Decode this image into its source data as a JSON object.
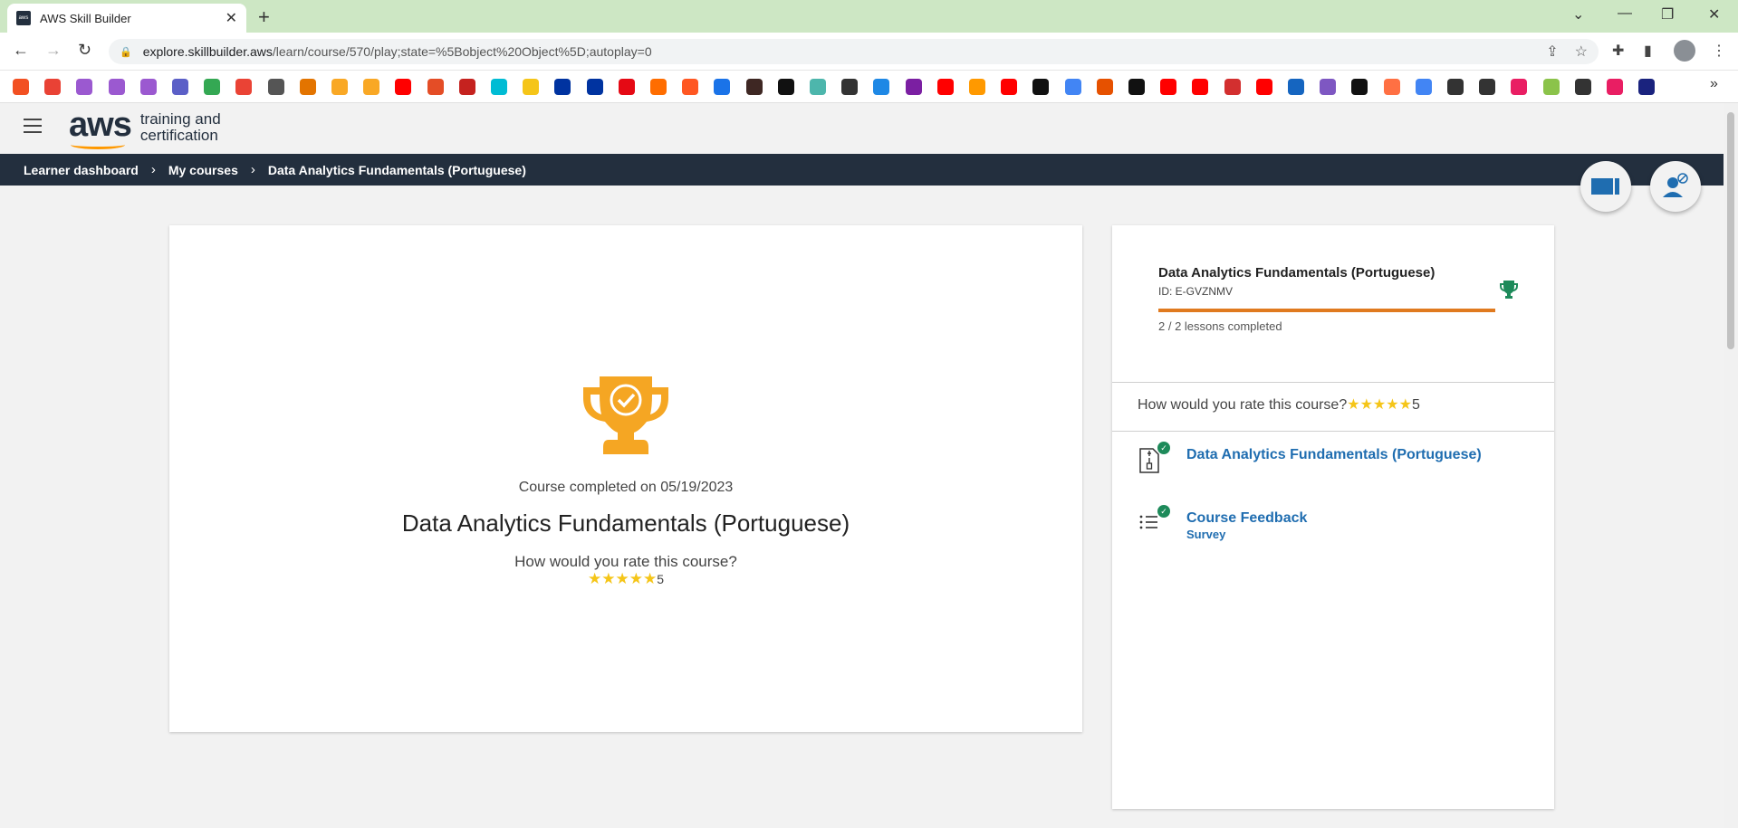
{
  "browser": {
    "tab_title": "AWS Skill Builder",
    "url_host": "explore.skillbuilder.aws",
    "url_path": "/learn/course/570/play;state=%5Bobject%20Object%5D;autoplay=0",
    "bookmark_colors": [
      "#f25022",
      "#e94235",
      "#9b59d0",
      "#9b59d0",
      "#9b59d0",
      "#5b5fc7",
      "#34a853",
      "#ea4335",
      "#555",
      "#e37400",
      "#f9a825",
      "#f9a825",
      "#ff0000",
      "#e44d26",
      "#c5221f",
      "#00bcd4",
      "#f5c518",
      "#0033a0",
      "#0033a0",
      "#e50914",
      "#ff6d00",
      "#ff5722",
      "#1a73e8",
      "#3e2723",
      "#111",
      "#4db6ac",
      "#333",
      "#1e88e5",
      "#7b1fa2",
      "#ff0000",
      "#ff9900",
      "#ff0000",
      "#111",
      "#4285f4",
      "#e65100",
      "#111",
      "#ff0000",
      "#ff0000",
      "#d32f2f",
      "#ff0000",
      "#1565c0",
      "#7e57c2",
      "#111",
      "#ff7043",
      "#4285f4",
      "#333",
      "#333",
      "#e91e63",
      "#8bc34a",
      "#333",
      "#e91e63",
      "#1a237e"
    ]
  },
  "header": {
    "logo_aws": "aws",
    "logo_line1": "training and",
    "logo_line2": "certification"
  },
  "breadcrumb": {
    "items": [
      "Learner dashboard",
      "My courses",
      "Data Analytics Fundamentals (Portuguese)"
    ],
    "separator": "›"
  },
  "main_card": {
    "completed_text": "Course completed on 05/19/2023",
    "course_title": "Data Analytics Fundamentals (Portuguese)",
    "rate_question": "How would you rate this course?",
    "rating_value": "5",
    "star_count": 5,
    "trophy_color": "#f5a623"
  },
  "sidebar": {
    "course_title": "Data Analytics Fundamentals (Portuguese)",
    "course_id": "ID: E-GVZNMV",
    "progress_fraction": 1.0,
    "lessons_text": "2 / 2 lessons completed",
    "rate_question": "How would you rate this course?",
    "rating_value": "5",
    "items": [
      {
        "title": "Data Analytics Fundamentals (Portuguese)",
        "subtitle": ""
      },
      {
        "title": "Course Feedback",
        "subtitle": "Survey"
      }
    ],
    "trophy_color": "#1d8a5a"
  },
  "colors": {
    "accent_orange": "#e07a1f",
    "link_blue": "#1f6db0",
    "nav_dark": "#232f3e",
    "complete_green": "#1d8a5a"
  }
}
